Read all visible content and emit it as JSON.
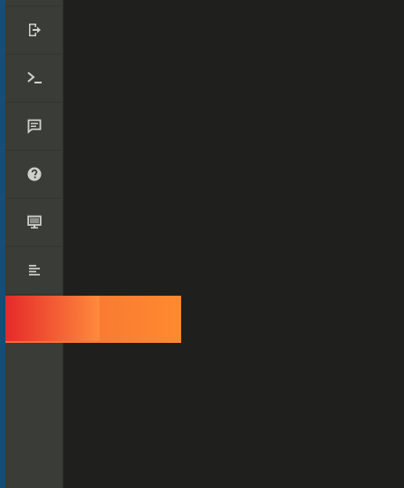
{
  "sidebar": {
    "items": [
      {
        "icon": "logout-icon"
      },
      {
        "icon": "terminal-icon"
      },
      {
        "icon": "comment-icon"
      },
      {
        "icon": "help-icon"
      },
      {
        "icon": "monitor-icon"
      },
      {
        "icon": "align-left-icon"
      }
    ]
  },
  "colors": {
    "background": "#1f201e",
    "sidebar": "#3a3c37",
    "edge": "#134d78",
    "icon": "#cfd0cc",
    "banner_start": "#e52a2a",
    "banner_end": "#ff8a2e"
  }
}
